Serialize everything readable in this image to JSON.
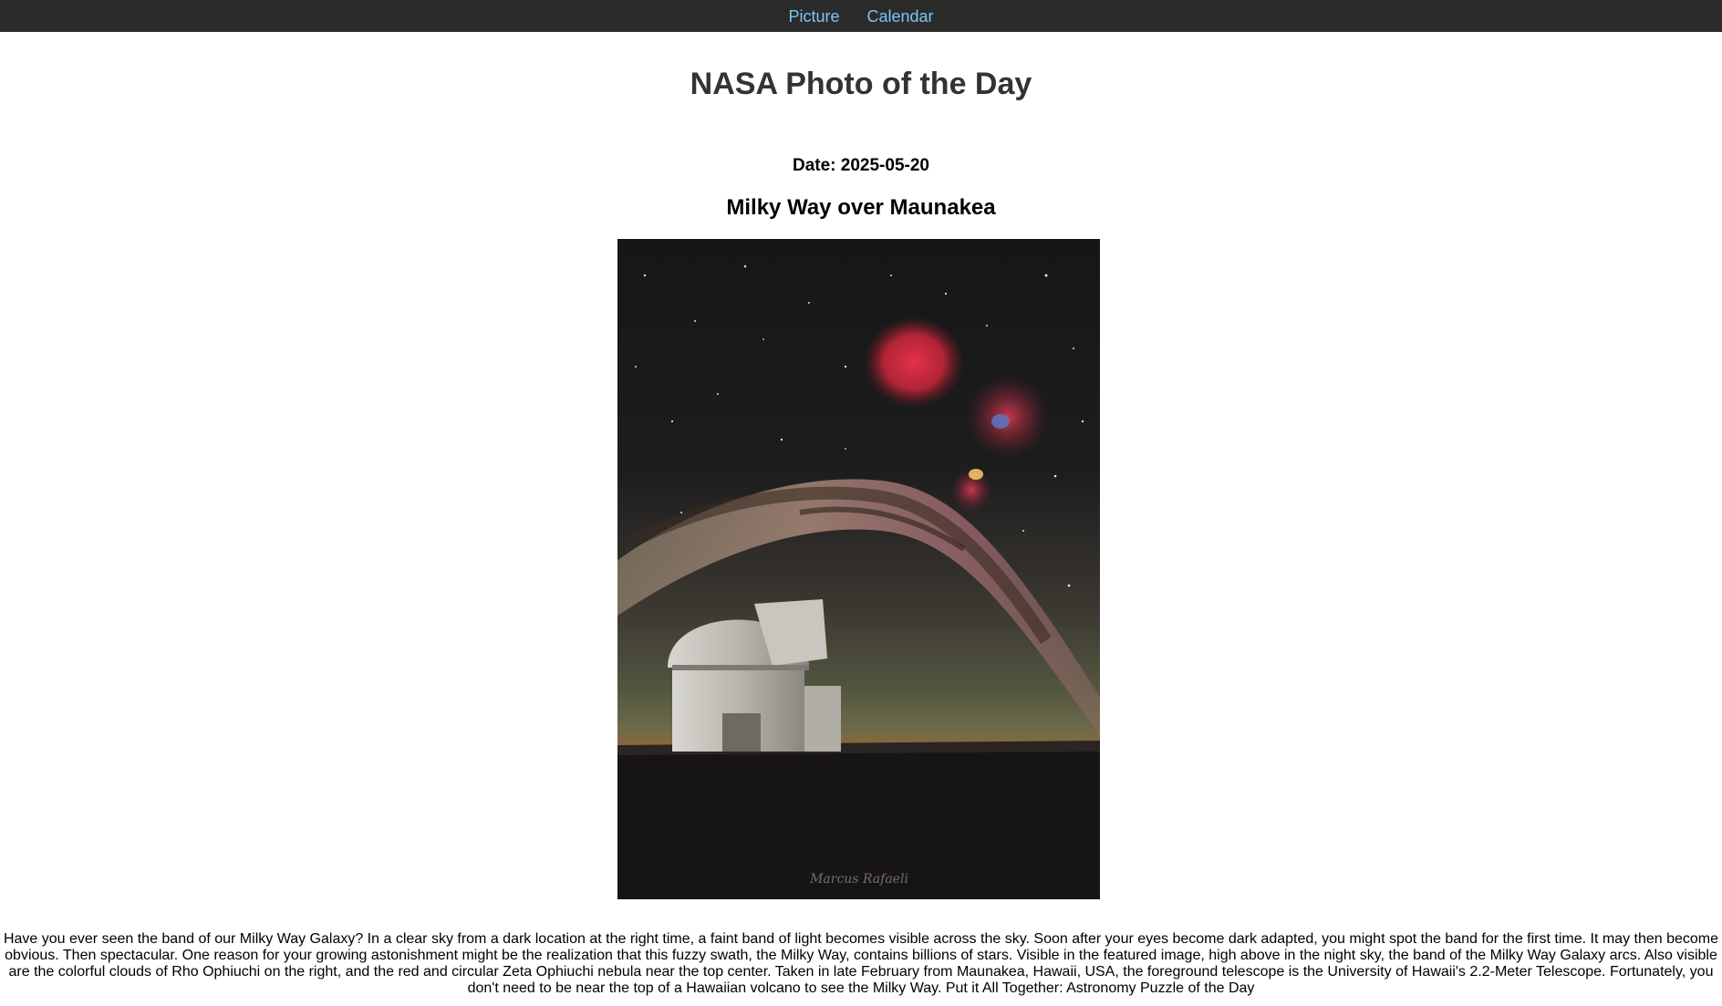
{
  "nav": {
    "picture_label": "Picture",
    "calendar_label": "Calendar"
  },
  "page": {
    "title": "NASA Photo of the Day"
  },
  "apod": {
    "date_line": "Date: 2025-05-20",
    "title": "Milky Way over Maunakea",
    "image_alt": "Milky Way over Maunakea",
    "explanation": "Have you ever seen the band of our Milky Way Galaxy? In a clear sky from a dark location at the right time, a faint band of light becomes visible across the sky. Soon after your eyes become dark adapted, you might spot the band for the first time. It may then become obvious. Then spectacular. One reason for your growing astonishment might be the realization that this fuzzy swath, the Milky Way, contains billions of stars. Visible in the featured image, high above in the night sky, the band of the Milky Way Galaxy arcs. Also visible are the colorful clouds of Rho Ophiuchi on the right, and the red and circular Zeta Ophiuchi nebula near the top center. Taken in late February from Maunakea, Hawaii, USA, the foreground telescope is the University of Hawaii's 2.2-Meter Telescope. Fortunately, you don't need to be near the top of a Hawaiian volcano to see the Milky Way. Put it All Together: Astronomy Puzzle of the Day"
  },
  "colors": {
    "nav_bg": "#2b2b2b",
    "nav_link": "#7cc4f4",
    "title_text": "#333333"
  }
}
